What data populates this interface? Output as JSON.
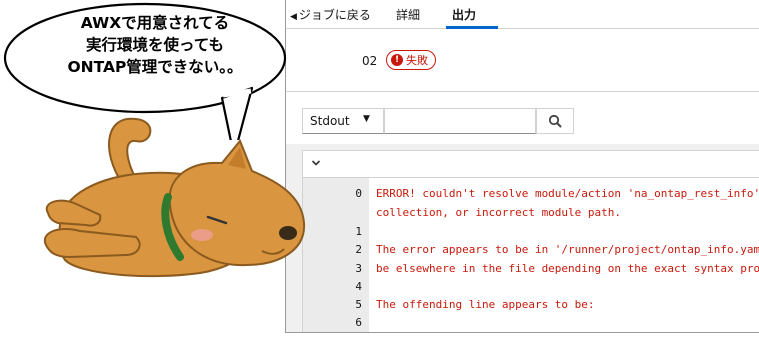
{
  "tabs": {
    "back_label": "ジョブに戻る",
    "details_label": "詳細",
    "output_label": "出力"
  },
  "job": {
    "id_fragment": "02",
    "status_label": "失敗",
    "status_icon_glyph": "!"
  },
  "toolbar": {
    "stdout_label": "Stdout",
    "search_value": ""
  },
  "output": {
    "lines": [
      {
        "num": "0",
        "text": "ERROR! couldn't resolve module/action 'na_ontap_rest_info'. This"
      },
      {
        "num": "",
        "text": "collection, or incorrect module path."
      },
      {
        "num": "1",
        "text": ""
      },
      {
        "num": "2",
        "text": "The error appears to be in '/runner/project/ontap_info.yaml': li"
      },
      {
        "num": "3",
        "text": "be elsewhere in the file depending on the exact syntax problem."
      },
      {
        "num": "4",
        "text": ""
      },
      {
        "num": "5",
        "text": "The offending line appears to be:"
      },
      {
        "num": "6",
        "text": ""
      }
    ]
  },
  "bubble": {
    "line1": "AWXで用意されてる",
    "line2": "実行環境を使っても",
    "line3": "ONTAP管理できない。。"
  },
  "colors": {
    "accent": "#0066cc",
    "error": "#c9190b",
    "gutter": "#ebebeb",
    "dog_body": "#d9953f"
  }
}
